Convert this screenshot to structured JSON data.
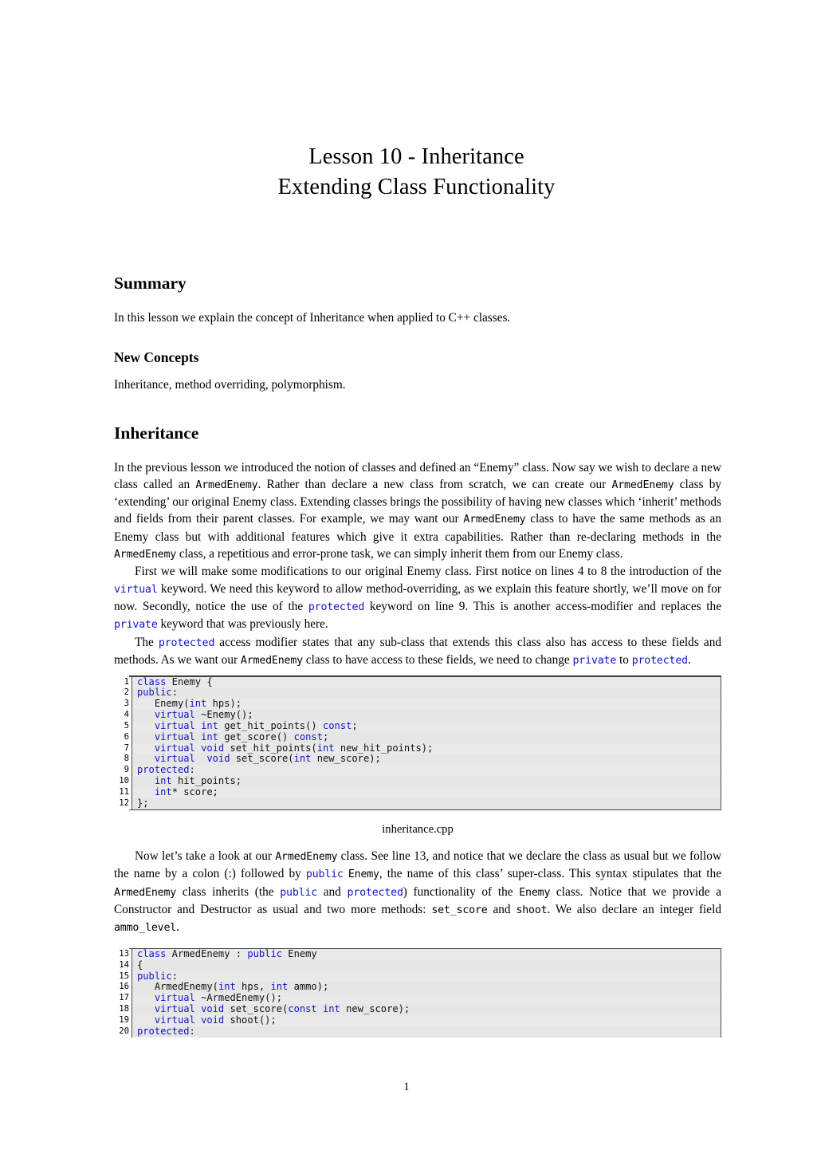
{
  "document": {
    "title_lines": [
      "Lesson 10 - Inheritance",
      "Extending Class Functionality"
    ],
    "page_number": "1"
  },
  "sections": {
    "summary": {
      "heading": "Summary",
      "paragraph": "In this lesson we explain the concept of Inheritance when applied to C++ classes."
    },
    "new_concepts": {
      "heading": "New Concepts",
      "paragraph": "Inheritance, method overriding, polymorphism."
    },
    "inheritance": {
      "heading": "Inheritance",
      "p1": {
        "t1": "In the previous lesson we introduced the notion of classes and defined an “Enemy” class. Now say we wish to declare a new class called an ",
        "c1": "ArmedEnemy",
        "t2": ". Rather than declare a new class from scratch, we can create our ",
        "c2": "ArmedEnemy",
        "t3": " class by ‘extending’ our original Enemy class. Extending classes brings the possibility of having new classes which ‘inherit’ methods and fields from their parent classes. For example, we may want our ",
        "c3": "ArmedEnemy",
        "t4": " class to have the same methods as an Enemy class but with additional features which give it extra capabilities. Rather than re-declaring methods in the ",
        "c4": "ArmedEnemy",
        "t5": " class, a repetitious and error-prone task, we can simply inherit them from our Enemy class."
      },
      "p2": {
        "t1": "First we will make some modifications to our original Enemy class. First notice on lines 4 to 8 the introduction of the ",
        "k1": "virtual",
        "t2": " keyword. We need this keyword to allow method-overriding, as we explain this feature shortly, we’ll move on for now. Secondly, notice the use of the ",
        "k2": "protected",
        "t3": " keyword on line 9. This is another access-modifier and replaces the ",
        "k3": "private",
        "t4": " keyword that was previously here."
      },
      "p3": {
        "t1": "The ",
        "k1": "protected",
        "t2": " access modifier states that any sub-class that extends this class also has access to these fields and methods. As we want our ",
        "c1": "ArmedEnemy",
        "t3": " class to have access to these fields, we need to change ",
        "k2": "private",
        "t4": " to ",
        "k3": "protected",
        "t5": "."
      },
      "p4": {
        "t1": "Now let’s take a look at our ",
        "c1": "ArmedEnemy",
        "t2": " class. See line 13, and notice that we declare the class as usual but we follow the name by a colon (:) followed by ",
        "k1": "public",
        "t3": " ",
        "c2": "Enemy",
        "t4": ", the name of this class’ super-class. This syntax stipulates that the ",
        "c3": "ArmedEnemy",
        "t5": " class inherits (the ",
        "k2": "public",
        "t6": " and ",
        "k3": "protected",
        "t7": ") functionality of the ",
        "c4": "Enemy",
        "t8": " class. Notice that we provide a Constructor and Destructor as usual and two more methods: ",
        "c5": "set_score",
        "t9": " and ",
        "c6": "shoot",
        "t10": ". We also declare an integer field ",
        "c7": "ammo_level",
        "t11": "."
      }
    }
  },
  "listings": [
    {
      "caption": "inheritance.cpp",
      "lines": [
        {
          "no": "1",
          "tokens": [
            {
              "t": "class",
              "kw": true
            },
            {
              "t": " Enemy {",
              "kw": false
            }
          ]
        },
        {
          "no": "2",
          "tokens": [
            {
              "t": "public",
              "kw": true
            },
            {
              "t": ":",
              "kw": false
            }
          ]
        },
        {
          "no": "3",
          "tokens": [
            {
              "t": "   Enemy(",
              "kw": false
            },
            {
              "t": "int",
              "kw": true
            },
            {
              "t": " hps);",
              "kw": false
            }
          ]
        },
        {
          "no": "4",
          "tokens": [
            {
              "t": "   ",
              "kw": false
            },
            {
              "t": "virtual",
              "kw": true
            },
            {
              "t": " ~Enemy();",
              "kw": false
            }
          ]
        },
        {
          "no": "5",
          "tokens": [
            {
              "t": "   ",
              "kw": false
            },
            {
              "t": "virtual int",
              "kw": true
            },
            {
              "t": " get_hit_points() ",
              "kw": false
            },
            {
              "t": "const",
              "kw": true
            },
            {
              "t": ";",
              "kw": false
            }
          ]
        },
        {
          "no": "6",
          "tokens": [
            {
              "t": "   ",
              "kw": false
            },
            {
              "t": "virtual int",
              "kw": true
            },
            {
              "t": " get_score() ",
              "kw": false
            },
            {
              "t": "const",
              "kw": true
            },
            {
              "t": ";",
              "kw": false
            }
          ]
        },
        {
          "no": "7",
          "tokens": [
            {
              "t": "   ",
              "kw": false
            },
            {
              "t": "virtual void",
              "kw": true
            },
            {
              "t": " set_hit_points(",
              "kw": false
            },
            {
              "t": "int",
              "kw": true
            },
            {
              "t": " new_hit_points);",
              "kw": false
            }
          ]
        },
        {
          "no": "8",
          "tokens": [
            {
              "t": "   ",
              "kw": false
            },
            {
              "t": "virtual",
              "kw": true
            },
            {
              "t": "  ",
              "kw": false
            },
            {
              "t": "void",
              "kw": true
            },
            {
              "t": " set_score(",
              "kw": false
            },
            {
              "t": "int",
              "kw": true
            },
            {
              "t": " new_score);",
              "kw": false
            }
          ]
        },
        {
          "no": "9",
          "tokens": [
            {
              "t": "protected",
              "kw": true
            },
            {
              "t": ":",
              "kw": false
            }
          ]
        },
        {
          "no": "10",
          "tokens": [
            {
              "t": "   ",
              "kw": false
            },
            {
              "t": "int",
              "kw": true
            },
            {
              "t": " hit_points;",
              "kw": false
            }
          ]
        },
        {
          "no": "11",
          "tokens": [
            {
              "t": "   ",
              "kw": false
            },
            {
              "t": "int",
              "kw": true
            },
            {
              "t": "* score;",
              "kw": false
            }
          ]
        },
        {
          "no": "12",
          "tokens": [
            {
              "t": "};",
              "kw": false
            }
          ]
        }
      ]
    },
    {
      "caption": "",
      "lines": [
        {
          "no": "13",
          "tokens": [
            {
              "t": "class",
              "kw": true
            },
            {
              "t": " ArmedEnemy : ",
              "kw": false
            },
            {
              "t": "public",
              "kw": true
            },
            {
              "t": " Enemy",
              "kw": false
            }
          ]
        },
        {
          "no": "14",
          "tokens": [
            {
              "t": "{",
              "kw": false
            }
          ]
        },
        {
          "no": "15",
          "tokens": [
            {
              "t": "public",
              "kw": true
            },
            {
              "t": ":",
              "kw": false
            }
          ]
        },
        {
          "no": "16",
          "tokens": [
            {
              "t": "   ArmedEnemy(",
              "kw": false
            },
            {
              "t": "int",
              "kw": true
            },
            {
              "t": " hps, ",
              "kw": false
            },
            {
              "t": "int",
              "kw": true
            },
            {
              "t": " ammo);",
              "kw": false
            }
          ]
        },
        {
          "no": "17",
          "tokens": [
            {
              "t": "   ",
              "kw": false
            },
            {
              "t": "virtual",
              "kw": true
            },
            {
              "t": " ~ArmedEnemy();",
              "kw": false
            }
          ]
        },
        {
          "no": "18",
          "tokens": [
            {
              "t": "   ",
              "kw": false
            },
            {
              "t": "virtual void",
              "kw": true
            },
            {
              "t": " set_score(",
              "kw": false
            },
            {
              "t": "const int",
              "kw": true
            },
            {
              "t": " new_score);",
              "kw": false
            }
          ]
        },
        {
          "no": "19",
          "tokens": [
            {
              "t": "   ",
              "kw": false
            },
            {
              "t": "virtual void",
              "kw": true
            },
            {
              "t": " shoot();",
              "kw": false
            }
          ]
        },
        {
          "no": "20",
          "tokens": [
            {
              "t": "protected",
              "kw": true
            },
            {
              "t": ":",
              "kw": false
            }
          ]
        }
      ]
    }
  ],
  "colors": {
    "keyword_blue": "#1414c8",
    "code_background": "#e9e9e9",
    "code_border": "#4a4a4a"
  }
}
